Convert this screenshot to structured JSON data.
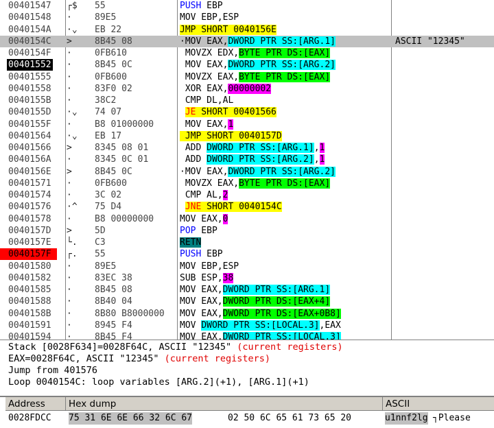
{
  "cpu": {
    "rows": [
      {
        "addr": "00401547",
        "tree": "┌$",
        "hex": "55",
        "asm": [
          {
            "t": "PUSH",
            "c": "blue"
          },
          {
            "t": " EBP"
          }
        ]
      },
      {
        "addr": "00401548",
        "tree": "·",
        "hex": "89E5",
        "asm": [
          {
            "t": "MOV EBP,ESP"
          }
        ]
      },
      {
        "addr": "0040154A",
        "tree": "·⌄",
        "hex": "EB 22",
        "asm": [
          {
            "t": "JMP SHORT 0040156E",
            "c": "hl-y"
          }
        ]
      },
      {
        "addr": "0040154C",
        "tree": ">",
        "hex": "8B45 08",
        "sel": true,
        "asm": [
          {
            "t": "·MOV EAX,"
          },
          {
            "t": "DWORD PTR SS:[ARG.1]",
            "c": "hl-c"
          }
        ],
        "comment": "ASCII \"12345\""
      },
      {
        "addr": "0040154F",
        "tree": "·",
        "hex": "0FB610",
        "asm": [
          {
            "t": " MOVZX EDX,"
          },
          {
            "t": "BYTE PTR DS:[EAX]",
            "c": "hl-g"
          }
        ]
      },
      {
        "addr": "00401552",
        "tree": "·",
        "hex": "8B45 0C",
        "addrStyle": "bk",
        "asm": [
          {
            "t": " MOV EAX,"
          },
          {
            "t": "DWORD PTR SS:[ARG.2]",
            "c": "hl-c"
          }
        ]
      },
      {
        "addr": "00401555",
        "tree": "·",
        "hex": "0FB600",
        "asm": [
          {
            "t": " MOVZX EAX,"
          },
          {
            "t": "BYTE PTR DS:[EAX]",
            "c": "hl-g"
          }
        ]
      },
      {
        "addr": "00401558",
        "tree": "·",
        "hex": "83F0 02",
        "asm": [
          {
            "t": " XOR EAX,"
          },
          {
            "t": "00000002",
            "c": "hl-m"
          }
        ]
      },
      {
        "addr": "0040155B",
        "tree": "·",
        "hex": "38C2",
        "asm": [
          {
            "t": " CMP DL,AL"
          }
        ]
      },
      {
        "addr": "0040155D",
        "tree": "·⌄",
        "hex": "74 07",
        "asm": [
          {
            "t": " "
          },
          {
            "t": "JE",
            "c": "hl-y red"
          },
          {
            "t": " SHORT 00401566",
            "c": "hl-y"
          }
        ]
      },
      {
        "addr": "0040155F",
        "tree": "·",
        "hex": "B8 01000000",
        "asm": [
          {
            "t": " MOV EAX,"
          },
          {
            "t": "1",
            "c": "hl-m"
          }
        ]
      },
      {
        "addr": "00401564",
        "tree": "·⌄",
        "hex": "EB 17",
        "asm": [
          {
            "t": " JMP SHORT 0040157D",
            "c": "hl-y"
          }
        ]
      },
      {
        "addr": "00401566",
        "tree": ">",
        "hex": "8345 08 01",
        "asm": [
          {
            "t": " ADD "
          },
          {
            "t": "DWORD PTR SS:[ARG.1]",
            "c": "hl-c"
          },
          {
            "t": ","
          },
          {
            "t": "1",
            "c": "hl-m"
          }
        ]
      },
      {
        "addr": "0040156A",
        "tree": "·",
        "hex": "8345 0C 01",
        "asm": [
          {
            "t": " ADD "
          },
          {
            "t": "DWORD PTR SS:[ARG.2]",
            "c": "hl-c"
          },
          {
            "t": ","
          },
          {
            "t": "1",
            "c": "hl-m"
          }
        ]
      },
      {
        "addr": "0040156E",
        "tree": ">",
        "hex": "8B45 0C",
        "asm": [
          {
            "t": "·MOV EAX,"
          },
          {
            "t": "DWORD PTR SS:[ARG.2]",
            "c": "hl-c"
          }
        ]
      },
      {
        "addr": "00401571",
        "tree": "·",
        "hex": "0FB600",
        "asm": [
          {
            "t": " MOVZX EAX,"
          },
          {
            "t": "BYTE PTR DS:[EAX]",
            "c": "hl-g"
          }
        ]
      },
      {
        "addr": "00401574",
        "tree": "·",
        "hex": "3C 02",
        "asm": [
          {
            "t": " CMP AL,"
          },
          {
            "t": "2",
            "c": "hl-m"
          }
        ]
      },
      {
        "addr": "00401576",
        "tree": "·^",
        "hex": "75 D4",
        "asm": [
          {
            "t": " "
          },
          {
            "t": "JNE",
            "c": "hl-y red"
          },
          {
            "t": " SHORT 0040154C",
            "c": "hl-y"
          }
        ]
      },
      {
        "addr": "00401578",
        "tree": "·",
        "hex": "B8 00000000",
        "asm": [
          {
            "t": "MOV EAX,"
          },
          {
            "t": "0",
            "c": "hl-m"
          }
        ]
      },
      {
        "addr": "0040157D",
        "tree": ">",
        "hex": "5D",
        "asm": [
          {
            "t": "POP",
            "c": "blue"
          },
          {
            "t": " EBP"
          }
        ]
      },
      {
        "addr": "0040157E",
        "tree": "└.",
        "hex": "C3",
        "asm": [
          {
            "t": "RETN",
            "c": "hl-t"
          }
        ]
      },
      {
        "addr": "0040157F",
        "tree": "┌.",
        "hex": "55",
        "addrStyle": "bp",
        "asm": [
          {
            "t": "PUSH",
            "c": "blue"
          },
          {
            "t": " EBP"
          }
        ]
      },
      {
        "addr": "00401580",
        "tree": "·",
        "hex": "89E5",
        "asm": [
          {
            "t": "MOV EBP,ESP"
          }
        ]
      },
      {
        "addr": "00401582",
        "tree": "·",
        "hex": "83EC 38",
        "asm": [
          {
            "t": "SUB ESP,"
          },
          {
            "t": "38",
            "c": "hl-m"
          }
        ]
      },
      {
        "addr": "00401585",
        "tree": "·",
        "hex": "8B45 08",
        "asm": [
          {
            "t": "MOV EAX,"
          },
          {
            "t": "DWORD PTR SS:[ARG.1]",
            "c": "hl-c"
          }
        ]
      },
      {
        "addr": "00401588",
        "tree": "·",
        "hex": "8B40 04",
        "asm": [
          {
            "t": "MOV EAX,"
          },
          {
            "t": "DWORD PTR DS:[EAX+4]",
            "c": "hl-g"
          }
        ]
      },
      {
        "addr": "0040158B",
        "tree": "·",
        "hex": "8B80 B8000000",
        "asm": [
          {
            "t": "MOV EAX,"
          },
          {
            "t": "DWORD PTR DS:[EAX+0B8]",
            "c": "hl-g"
          }
        ]
      },
      {
        "addr": "00401591",
        "tree": "·",
        "hex": "8945 F4",
        "asm": [
          {
            "t": "MOV "
          },
          {
            "t": "DWORD PTR SS:[LOCAL.3]",
            "c": "hl-c"
          },
          {
            "t": ",EAX"
          }
        ]
      },
      {
        "addr": "00401594",
        "tree": "·",
        "hex": "8B45 F4",
        "asm": [
          {
            "t": "MOV EAX,"
          },
          {
            "t": "DWORD PTR SS:[LOCAL.3]",
            "c": "hl-c"
          }
        ]
      }
    ]
  },
  "info": {
    "line1": "Stack [0028F634]=0028F64C, ASCII \"12345\"",
    "line1_note": "(current registers)",
    "line2": "EAX=0028F64C, ASCII \"12345\"",
    "line2_note": "(current registers)",
    "line3": "Jump from 401576",
    "line4": "Loop 0040154C: loop variables [ARG.2](+1), [ARG.1](+1)"
  },
  "dump": {
    "col_address": "Address",
    "col_hex": "Hex dump",
    "col_ascii": "ASCII",
    "row": {
      "addr": "0028FDCC",
      "hex_sel": "75 31 6E 6E 66 32 6C 67",
      "hex_rest": "02 50 6C 65 61 73 65 20",
      "ascii_sel": "u1nnf2lg",
      "ascii_rest": "┐Please "
    }
  }
}
